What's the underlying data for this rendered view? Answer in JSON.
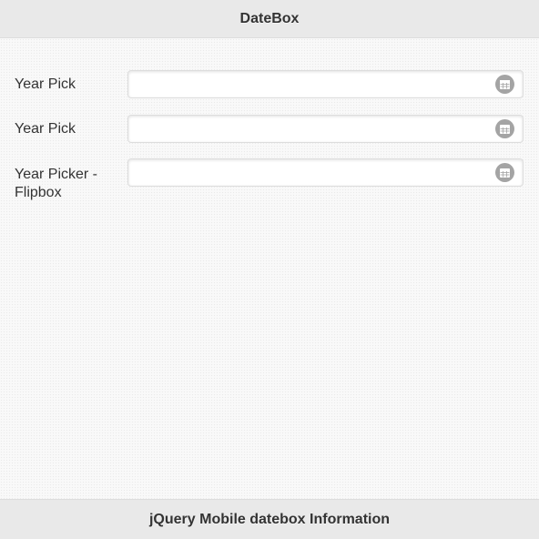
{
  "header": {
    "title": "DateBox"
  },
  "fields": [
    {
      "label": "Year Pick",
      "value": "",
      "icon": "calendar-icon"
    },
    {
      "label": "Year Pick",
      "value": "",
      "icon": "calendar-icon"
    },
    {
      "label": "Year Picker - Flipbox",
      "value": "",
      "icon": "calendar-icon"
    }
  ],
  "footer": {
    "title": "jQuery Mobile datebox Information"
  },
  "colors": {
    "bar_background": "#e9e9e9",
    "icon_background": "#a4a4a4",
    "text": "#333333"
  }
}
